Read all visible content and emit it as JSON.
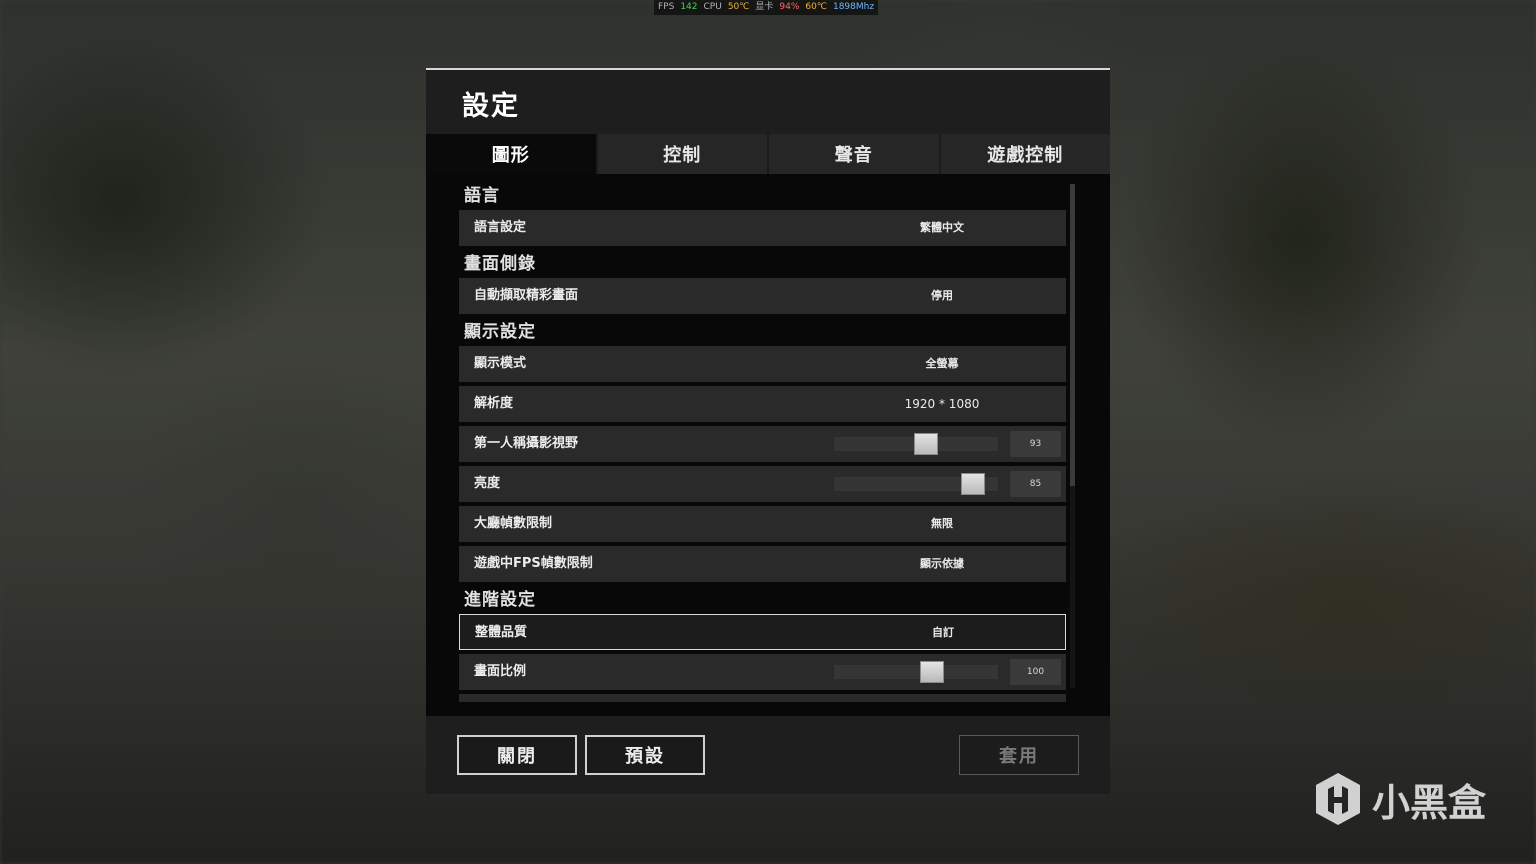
{
  "overlay": {
    "fps_label": "FPS",
    "fps_value": "142",
    "cpu_label": "CPU",
    "cpu_temp": "50℃",
    "gpu_label": "显卡",
    "gpu_usage": "94%",
    "gpu_temp": "60℃",
    "gpu_clock": "1898Mhz"
  },
  "dialog": {
    "title": "設定",
    "tabs": [
      {
        "label": "圖形",
        "active": true
      },
      {
        "label": "控制"
      },
      {
        "label": "聲音"
      },
      {
        "label": "遊戲控制"
      }
    ]
  },
  "sections": {
    "language": {
      "title": "語言",
      "language_setting": {
        "label": "語言設定",
        "value": "繁體中文"
      }
    },
    "replay": {
      "title": "畫面側錄",
      "auto_highlight": {
        "label": "自動擷取精彩畫面",
        "value": "停用"
      }
    },
    "display": {
      "title": "顯示設定",
      "display_mode": {
        "label": "顯示模式",
        "value": "全螢幕"
      },
      "resolution": {
        "label": "解析度",
        "value": "1920 * 1080"
      },
      "fpp_fov": {
        "label": "第一人稱攝影視野",
        "value": "93",
        "slider_fraction": 0.56
      },
      "brightness": {
        "label": "亮度",
        "value": "85",
        "slider_fraction": 0.85
      },
      "lobby_fps_limit": {
        "label": "大廳幀數限制",
        "value": "無限"
      },
      "ingame_fps_limit": {
        "label": "遊戲中FPS幀數限制",
        "value": "顯示依據"
      }
    },
    "advanced": {
      "title": "進階設定",
      "overall_quality": {
        "label": "整體品質",
        "value": "自訂"
      },
      "screen_scale": {
        "label": "畫面比例",
        "value": "100",
        "slider_fraction": 0.6
      }
    }
  },
  "buttons": {
    "close": "關閉",
    "default": "預設",
    "apply": "套用"
  },
  "watermark": {
    "text": "小黑盒"
  },
  "colors": {
    "overlay_green": "#3fd25c",
    "overlay_orange": "#f2b239",
    "overlay_red": "#ff6a6a",
    "overlay_blue": "#6ab7ff"
  }
}
